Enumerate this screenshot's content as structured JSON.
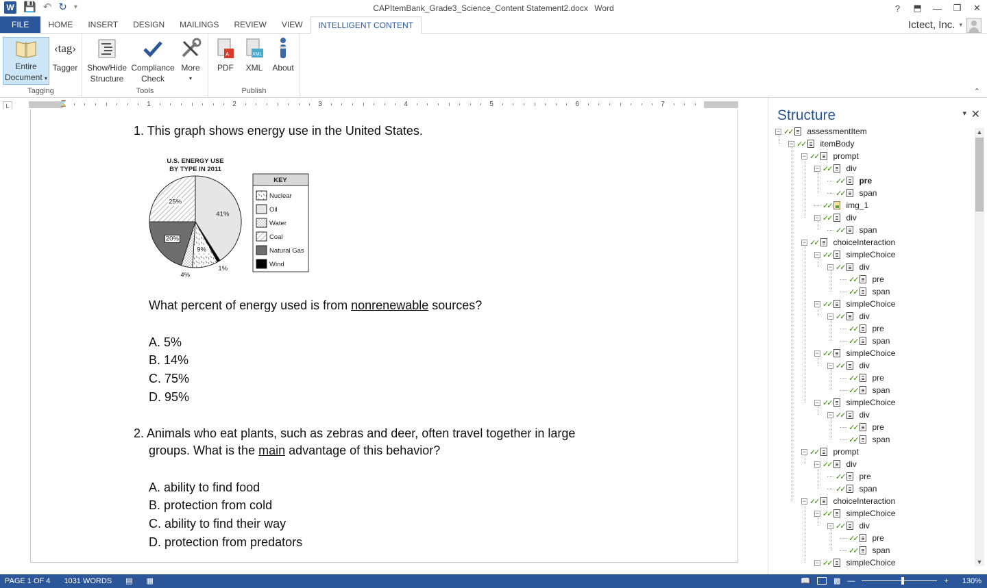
{
  "titlebar": {
    "doc_name": "CAPItemBank_Grade3_Science_Content Statement2.docx",
    "app_name": "Word",
    "help": "?",
    "ribbon_display": "⬒",
    "minimize": "—",
    "maximize": "❐",
    "close": "✕"
  },
  "tabs": [
    "FILE",
    "HOME",
    "INSERT",
    "DESIGN",
    "MAILINGS",
    "REVIEW",
    "VIEW",
    "INTELLIGENT CONTENT"
  ],
  "account": {
    "name": "Ictect, Inc."
  },
  "ribbon": {
    "groups": {
      "tagging": "Tagging",
      "tools": "Tools",
      "publish": "Publish"
    },
    "buttons": {
      "entire_document_1": "Entire",
      "entire_document_2": "Document",
      "tagger": "Tagger",
      "tagger_icon_text": "‹tag›",
      "show_hide_1": "Show/Hide",
      "show_hide_2": "Structure",
      "compliance_1": "Compliance",
      "compliance_2": "Check",
      "more": "More",
      "pdf": "PDF",
      "xml": "XML",
      "about": "About"
    }
  },
  "ruler": {
    "numbers": [
      "1",
      "2",
      "3",
      "4",
      "5",
      "6",
      "7"
    ]
  },
  "document": {
    "q1": {
      "number": "1.",
      "text": "This graph shows energy use in the United States.",
      "question_pre": "What percent of energy used is from ",
      "question_u": "nonrenewable",
      "question_post": " sources?",
      "options": [
        "A. 5%",
        "B. 14%",
        "C. 75%",
        "D. 95%"
      ]
    },
    "q2": {
      "number": "2.",
      "line1": "Animals who eat plants, such as zebras and deer, often travel together in large",
      "line2_pre": "groups. What is the ",
      "line2_u": "main",
      "line2_post": " advantage of this behavior?",
      "options": [
        "A. ability to find food",
        "B. protection from cold",
        "C. ability to find their way",
        "D. protection from predators"
      ]
    }
  },
  "chart_data": {
    "type": "pie",
    "title": "U.S. ENERGY USE BY TYPE IN 2011",
    "title_line1": "U.S. ENERGY USE",
    "title_line2": "BY TYPE IN 2011",
    "legend_title": "KEY",
    "slices": [
      {
        "name": "Oil",
        "value": 41,
        "label": "41%"
      },
      {
        "name": "Wind",
        "value": 1,
        "label": "1%"
      },
      {
        "name": "Nuclear",
        "value": 9,
        "label": "9%"
      },
      {
        "name": "Water",
        "value": 4,
        "label": "4%"
      },
      {
        "name": "Natural Gas",
        "value": 20,
        "label": "20%"
      },
      {
        "name": "Coal",
        "value": 25,
        "label": "25%"
      }
    ],
    "legend": [
      "Nuclear",
      "Oil",
      "Water",
      "Coal",
      "Natural Gas",
      "Wind"
    ]
  },
  "structure": {
    "title": "Structure",
    "nodes": [
      {
        "label": "assessmentItem",
        "depth": 0,
        "exp": true
      },
      {
        "label": "itemBody",
        "depth": 1,
        "exp": true
      },
      {
        "label": "prompt",
        "depth": 2,
        "exp": true
      },
      {
        "label": "div",
        "depth": 3,
        "exp": true
      },
      {
        "label": "pre",
        "depth": 4,
        "exp": false,
        "bold": true
      },
      {
        "label": "span",
        "depth": 4,
        "exp": false
      },
      {
        "label": "img_1",
        "depth": 3,
        "exp": false,
        "img": true
      },
      {
        "label": "div",
        "depth": 3,
        "exp": true
      },
      {
        "label": "span",
        "depth": 4,
        "exp": false
      },
      {
        "label": "choiceInteraction",
        "depth": 2,
        "exp": true
      },
      {
        "label": "simpleChoice",
        "depth": 3,
        "exp": true
      },
      {
        "label": "div",
        "depth": 4,
        "exp": true
      },
      {
        "label": "pre",
        "depth": 5,
        "exp": false
      },
      {
        "label": "span",
        "depth": 5,
        "exp": false
      },
      {
        "label": "simpleChoice",
        "depth": 3,
        "exp": true
      },
      {
        "label": "div",
        "depth": 4,
        "exp": true
      },
      {
        "label": "pre",
        "depth": 5,
        "exp": false
      },
      {
        "label": "span",
        "depth": 5,
        "exp": false
      },
      {
        "label": "simpleChoice",
        "depth": 3,
        "exp": true
      },
      {
        "label": "div",
        "depth": 4,
        "exp": true
      },
      {
        "label": "pre",
        "depth": 5,
        "exp": false
      },
      {
        "label": "span",
        "depth": 5,
        "exp": false
      },
      {
        "label": "simpleChoice",
        "depth": 3,
        "exp": true
      },
      {
        "label": "div",
        "depth": 4,
        "exp": true
      },
      {
        "label": "pre",
        "depth": 5,
        "exp": false
      },
      {
        "label": "span",
        "depth": 5,
        "exp": false
      },
      {
        "label": "prompt",
        "depth": 2,
        "exp": true
      },
      {
        "label": "div",
        "depth": 3,
        "exp": true
      },
      {
        "label": "pre",
        "depth": 4,
        "exp": false
      },
      {
        "label": "span",
        "depth": 4,
        "exp": false
      },
      {
        "label": "choiceInteraction",
        "depth": 2,
        "exp": true
      },
      {
        "label": "simpleChoice",
        "depth": 3,
        "exp": true
      },
      {
        "label": "div",
        "depth": 4,
        "exp": true
      },
      {
        "label": "pre",
        "depth": 5,
        "exp": false
      },
      {
        "label": "span",
        "depth": 5,
        "exp": false
      },
      {
        "label": "simpleChoice",
        "depth": 3,
        "exp": true
      }
    ]
  },
  "status": {
    "page": "PAGE 1 OF 4",
    "words": "1031 WORDS",
    "zoom": "130%",
    "zoom_level": 0.54
  },
  "colors": {
    "accent": "#2b579a",
    "check": "#2e8b00"
  }
}
